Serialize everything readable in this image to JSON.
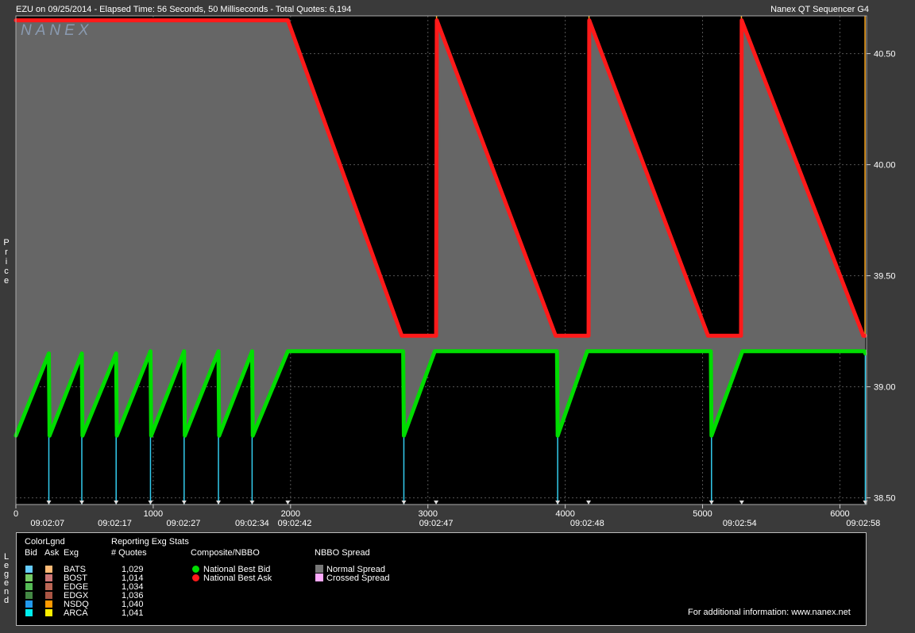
{
  "header": {
    "left_text": "EZU on 09/25/2014  -  Elapsed Time: 56 Seconds, 50 Milliseconds  -  Total Quotes: 6,194",
    "right_text": "Nanex QT Sequencer G4",
    "watermark": "NANEX"
  },
  "colors": {
    "plot_bg": "#000000",
    "spread_fill": "#666666",
    "bid": "#00dd00",
    "ask": "#ff1a1a",
    "bid_exch_line": "#33ccee",
    "ask_exch_line": "#ffaa22",
    "grid": "#555555"
  },
  "chart_data": {
    "type": "line",
    "title": "",
    "ylabel": "Price",
    "xlabel": "",
    "xlim": [
      0,
      6194
    ],
    "ylim": [
      38.47,
      40.67
    ],
    "y_ticks": [
      "38.50",
      "39.00",
      "39.50",
      "40.00",
      "40.50"
    ],
    "x_ticks": [
      "0",
      "1000",
      "2000",
      "3000",
      "4000",
      "5000",
      "6000"
    ],
    "time_labels": [
      {
        "x": 230,
        "label": "09:02:07"
      },
      {
        "x": 720,
        "label": "09:02:17"
      },
      {
        "x": 1220,
        "label": "09:02:27"
      },
      {
        "x": 1720,
        "label": "09:02:34"
      },
      {
        "x": 2030,
        "label": "09:02:42"
      },
      {
        "x": 3060,
        "label": "09:02:47"
      },
      {
        "x": 4160,
        "label": "09:02:48"
      },
      {
        "x": 5270,
        "label": "09:02:54"
      },
      {
        "x": 6170,
        "label": "09:02:58"
      }
    ],
    "grid": true,
    "series": [
      {
        "name": "National Best Bid",
        "color": "#00dd00",
        "points": [
          [
            0,
            38.78
          ],
          [
            240,
            39.15
          ],
          [
            245,
            38.78
          ],
          [
            480,
            39.15
          ],
          [
            485,
            38.78
          ],
          [
            730,
            39.15
          ],
          [
            735,
            38.78
          ],
          [
            980,
            39.16
          ],
          [
            985,
            38.78
          ],
          [
            1225,
            39.16
          ],
          [
            1230,
            38.78
          ],
          [
            1475,
            39.16
          ],
          [
            1480,
            38.78
          ],
          [
            1720,
            39.16
          ],
          [
            1725,
            38.78
          ],
          [
            1980,
            39.16
          ],
          [
            2820,
            39.16
          ],
          [
            2825,
            38.78
          ],
          [
            3050,
            39.16
          ],
          [
            3940,
            39.16
          ],
          [
            3945,
            38.78
          ],
          [
            4160,
            39.16
          ],
          [
            5060,
            39.16
          ],
          [
            5065,
            38.78
          ],
          [
            5290,
            39.16
          ],
          [
            6180,
            39.16
          ],
          [
            6185,
            39.15
          ]
        ]
      },
      {
        "name": "National Best Ask",
        "color": "#ff1a1a",
        "points": [
          [
            0,
            40.65
          ],
          [
            1980,
            40.65
          ],
          [
            2810,
            39.23
          ],
          [
            3060,
            39.23
          ],
          [
            3065,
            40.65
          ],
          [
            3930,
            39.23
          ],
          [
            4170,
            39.23
          ],
          [
            4175,
            40.65
          ],
          [
            5040,
            39.23
          ],
          [
            5280,
            39.23
          ],
          [
            5285,
            40.65
          ],
          [
            6170,
            39.23
          ],
          [
            6185,
            39.23
          ]
        ]
      }
    ],
    "bid_drop_markers": [
      240,
      480,
      730,
      980,
      1225,
      1475,
      1720,
      2825,
      3945,
      5065,
      6185
    ],
    "ask_spike_markers": [
      3063,
      4173,
      5283,
      6183
    ],
    "triangle_markers": [
      240,
      480,
      730,
      980,
      1225,
      1475,
      1720,
      1980,
      2825,
      3060,
      3945,
      4170,
      5065,
      5285,
      6185
    ]
  },
  "legend": {
    "side_label": "Legend",
    "color_legend_title": "ColorLgnd",
    "col_bid": "Bid",
    "col_ask": "Ask",
    "col_exg": "Exg",
    "stats_title": "Reporting Exg Stats",
    "stats_col": "# Quotes",
    "exchanges": [
      {
        "name": "BATS",
        "quotes": "1,029",
        "bid_color": "#66ccff",
        "ask_color": "#ffbb77"
      },
      {
        "name": "BOST",
        "quotes": "1,014",
        "bid_color": "#77cc66",
        "ask_color": "#cc7777"
      },
      {
        "name": "EDGE",
        "quotes": "1,034",
        "bid_color": "#55bb55",
        "ask_color": "#bb6655"
      },
      {
        "name": "EDGX",
        "quotes": "1,036",
        "bid_color": "#448844",
        "ask_color": "#aa5544"
      },
      {
        "name": "NSDQ",
        "quotes": "1,040",
        "bid_color": "#2299ee",
        "ask_color": "#ff9900"
      },
      {
        "name": "ARCA",
        "quotes": "1,041",
        "bid_color": "#00eeee",
        "ask_color": "#ffee00"
      }
    ],
    "composite_title": "Composite/NBBO",
    "composite_items": [
      {
        "label": "National Best Bid",
        "color": "#00dd00"
      },
      {
        "label": "National Best Ask",
        "color": "#ff1a1a"
      }
    ],
    "spread_title": "NBBO Spread",
    "spread_items": [
      {
        "label": "Normal Spread",
        "color": "#777777"
      },
      {
        "label": "Crossed Spread",
        "color": "#ffaaff"
      }
    ],
    "footer": "For additional information: www.nanex.net"
  }
}
